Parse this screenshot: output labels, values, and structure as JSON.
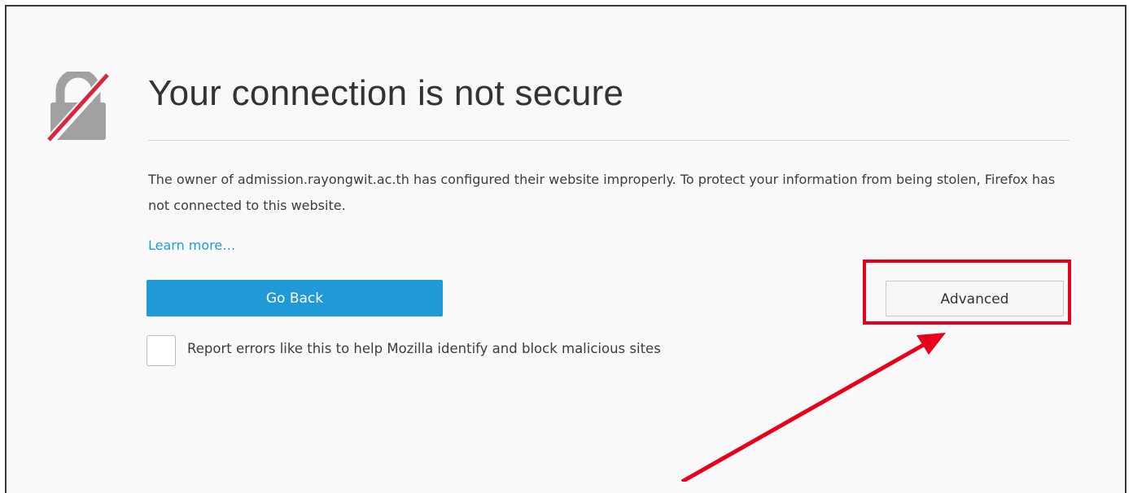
{
  "error_page": {
    "title": "Your connection is not secure",
    "description": "The owner of admission.rayongwit.ac.th has configured their website improperly. To protect your information from being stolen, Firefox has not connected to this website.",
    "learn_more": "Learn more…",
    "go_back_label": "Go Back",
    "advanced_label": "Advanced",
    "report_checkbox_checked": false,
    "report_label": "Report errors like this to help Mozilla identify and block malicious sites"
  },
  "icons": {
    "header": "broken-lock-icon"
  },
  "colors": {
    "background": "#f9f9fa",
    "primary_button": "#1f9ad6",
    "link": "#1f9dd9",
    "annotation": "#e8001b",
    "lock_gray": "#a1a1a1"
  }
}
